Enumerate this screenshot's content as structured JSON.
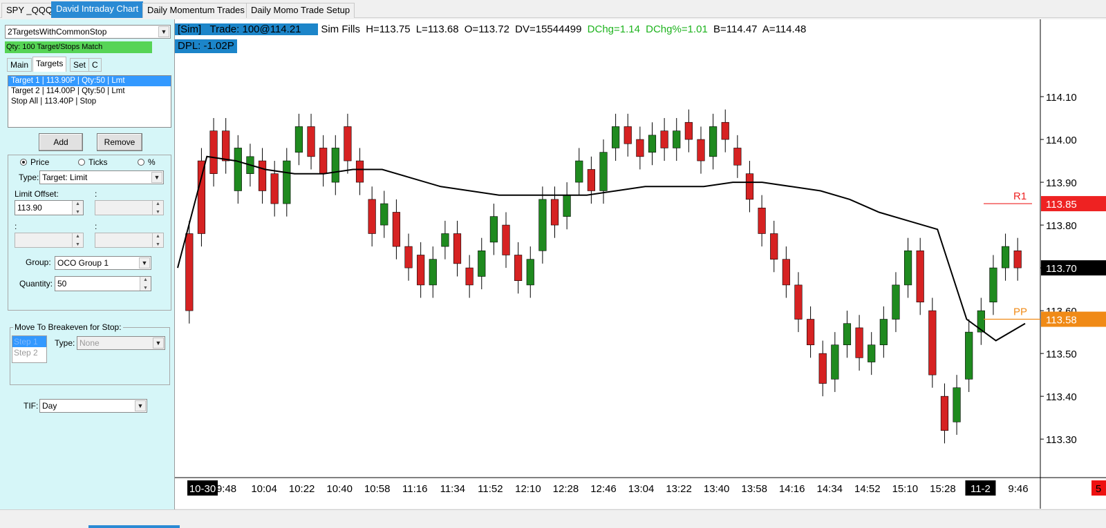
{
  "tabs": [
    "SPY _QQQ",
    "David Intraday Chart",
    "Daily Momentum Trades",
    "Daily Momo Trade Setup"
  ],
  "panel": {
    "strategy": "2TargetsWithCommonStop",
    "status": "Qty: 100 Target/Stops Match",
    "subtabs": [
      "Main",
      "Targets",
      "Set",
      "C"
    ],
    "targets": [
      "Target 1 | 113.90P | Qty:50 | Lmt",
      "Target 2 | 114.00P | Qty:50 | Lmt",
      "Stop All | 113.40P | Stop"
    ],
    "add_label": "Add",
    "remove_label": "Remove",
    "radio_price": "Price",
    "radio_ticks": "Ticks",
    "radio_pct": "%",
    "type_label": "Type:",
    "type_value": "Target: Limit",
    "limit_offset_label": "Limit Offset:",
    "limit_offset_value": "113.90",
    "colon": ":",
    "group_label": "Group:",
    "group_value": "OCO Group 1",
    "quantity_label": "Quantity:",
    "quantity_value": "50",
    "breakeven_title": "Move To Breakeven for Stop:",
    "steps": [
      "Step 1",
      "Step 2"
    ],
    "step_type_label": "Type:",
    "step_type_value": "None",
    "tif_label": "TIF:",
    "tif_value": "Day"
  },
  "header": {
    "sim": "[Sim]",
    "trade": "Trade: 100@114.21",
    "sim_fills": "Sim Fills",
    "high": "H=113.75",
    "low": "L=113.68",
    "open": "O=113.72",
    "dv": "DV=15544499",
    "dchg": "DChg=1.14",
    "dchg_pct": "DChg%=1.01",
    "bid": "B=114.47",
    "ask": "A=114.48",
    "dpl": "DPL: -1.02P"
  },
  "colors": {
    "up": "#1f8a1f",
    "down": "#d62222",
    "vwap": "#000000",
    "r1": "#ee2222",
    "pp": "#f08a16",
    "last": "#000000"
  },
  "chart_data": {
    "type": "candlestick",
    "y_ticks": [
      "114.10",
      "114.00",
      "113.90",
      "113.80",
      "113.70",
      "113.60",
      "113.50",
      "113.40",
      "113.30"
    ],
    "ylim": [
      113.21,
      114.2
    ],
    "x_labels": [
      "10-30",
      "9:48",
      "10:04",
      "10:22",
      "10:40",
      "10:58",
      "11:16",
      "11:34",
      "11:52",
      "12:10",
      "12:28",
      "12:46",
      "13:04",
      "13:22",
      "13:40",
      "13:58",
      "14:16",
      "14:34",
      "14:52",
      "15:10",
      "15:28",
      "11-2",
      "9:46"
    ],
    "price_labels": {
      "r1": {
        "label": "R1",
        "value": "113.85"
      },
      "pp": {
        "label": "PP",
        "value": "113.58"
      },
      "last": {
        "value": "113.70"
      },
      "corner": "5"
    },
    "candles_approx": [
      [
        113.78,
        113.6
      ],
      [
        113.95,
        113.78
      ],
      [
        114.02,
        113.92
      ],
      [
        114.02,
        113.95
      ],
      [
        113.88,
        113.98
      ],
      [
        113.92,
        113.96
      ],
      [
        113.95,
        113.88
      ],
      [
        113.92,
        113.85
      ],
      [
        113.85,
        113.95
      ],
      [
        113.97,
        114.03
      ],
      [
        114.03,
        113.96
      ],
      [
        113.98,
        113.92
      ],
      [
        113.9,
        113.98
      ],
      [
        114.03,
        113.95
      ],
      [
        113.95,
        113.9
      ],
      [
        113.86,
        113.78
      ],
      [
        113.8,
        113.85
      ],
      [
        113.83,
        113.75
      ],
      [
        113.75,
        113.7
      ],
      [
        113.73,
        113.66
      ],
      [
        113.66,
        113.72
      ],
      [
        113.75,
        113.78
      ],
      [
        113.78,
        113.71
      ],
      [
        113.7,
        113.66
      ],
      [
        113.68,
        113.74
      ],
      [
        113.76,
        113.82
      ],
      [
        113.8,
        113.73
      ],
      [
        113.73,
        113.67
      ],
      [
        113.66,
        113.72
      ],
      [
        113.74,
        113.86
      ],
      [
        113.86,
        113.8
      ],
      [
        113.82,
        113.87
      ],
      [
        113.9,
        113.95
      ],
      [
        113.93,
        113.88
      ],
      [
        113.88,
        113.97
      ],
      [
        113.98,
        114.03
      ],
      [
        114.03,
        113.99
      ],
      [
        114.0,
        113.96
      ],
      [
        113.97,
        114.01
      ],
      [
        114.02,
        113.98
      ],
      [
        113.98,
        114.02
      ],
      [
        114.04,
        114.0
      ],
      [
        114.0,
        113.95
      ],
      [
        113.96,
        114.03
      ],
      [
        114.04,
        114.0
      ],
      [
        113.98,
        113.94
      ],
      [
        113.92,
        113.86
      ],
      [
        113.84,
        113.78
      ],
      [
        113.78,
        113.72
      ],
      [
        113.72,
        113.66
      ],
      [
        113.66,
        113.58
      ],
      [
        113.58,
        113.52
      ],
      [
        113.5,
        113.43
      ],
      [
        113.44,
        113.52
      ],
      [
        113.52,
        113.57
      ],
      [
        113.56,
        113.49
      ],
      [
        113.48,
        113.52
      ],
      [
        113.52,
        113.58
      ],
      [
        113.58,
        113.66
      ],
      [
        113.66,
        113.74
      ],
      [
        113.74,
        113.62
      ],
      [
        113.6,
        113.45
      ],
      [
        113.4,
        113.32
      ],
      [
        113.34,
        113.42
      ],
      [
        113.44,
        113.55
      ],
      [
        113.55,
        113.6
      ],
      [
        113.62,
        113.7
      ],
      [
        113.7,
        113.75
      ],
      [
        113.74,
        113.7
      ]
    ],
    "vwap_approx": [
      113.7,
      113.96,
      113.95,
      113.93,
      113.92,
      113.92,
      113.93,
      113.93,
      113.91,
      113.89,
      113.88,
      113.87,
      113.87,
      113.87,
      113.87,
      113.88,
      113.89,
      113.89,
      113.89,
      113.9,
      113.9,
      113.89,
      113.88,
      113.86,
      113.83,
      113.81,
      113.79,
      113.58,
      113.53,
      113.57
    ]
  }
}
